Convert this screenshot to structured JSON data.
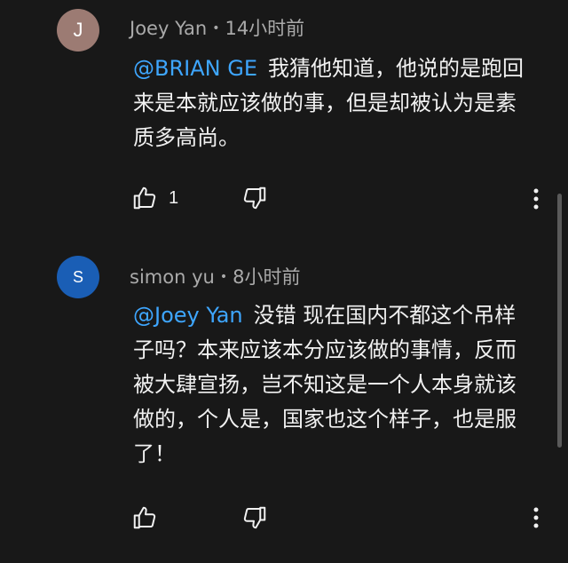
{
  "comments": [
    {
      "avatar_letter": "J",
      "avatar_color": "#9c7b73",
      "author": "Joey Yan",
      "separator": "•",
      "time": "14小时前",
      "mention": "@BRIAN GE",
      "text": "我猜他知道，他说的是跑回来是本就应该做的事，但是却被认为是素质多高尚。",
      "likes": "1"
    },
    {
      "avatar_letter": "S",
      "avatar_color": "#1a5eb5",
      "author": "simon yu",
      "separator": "•",
      "time": "8小时前",
      "mention": "@Joey Yan",
      "text": "没错 现在国内不都这个吊样子吗？本来应该本分应该做的事情，反而被大肆宣扬，岂不知这是一个人本身就该做的，个人是，国家也这个样子，也是服了！",
      "likes": ""
    }
  ],
  "icons": {
    "like": "thumb-up-icon",
    "dislike": "thumb-down-icon",
    "more": "more-vert-icon"
  },
  "colors": {
    "background": "#181818",
    "mention": "#3ea6ff",
    "meta": "#aaaaaa",
    "text": "#f1f1f1"
  }
}
